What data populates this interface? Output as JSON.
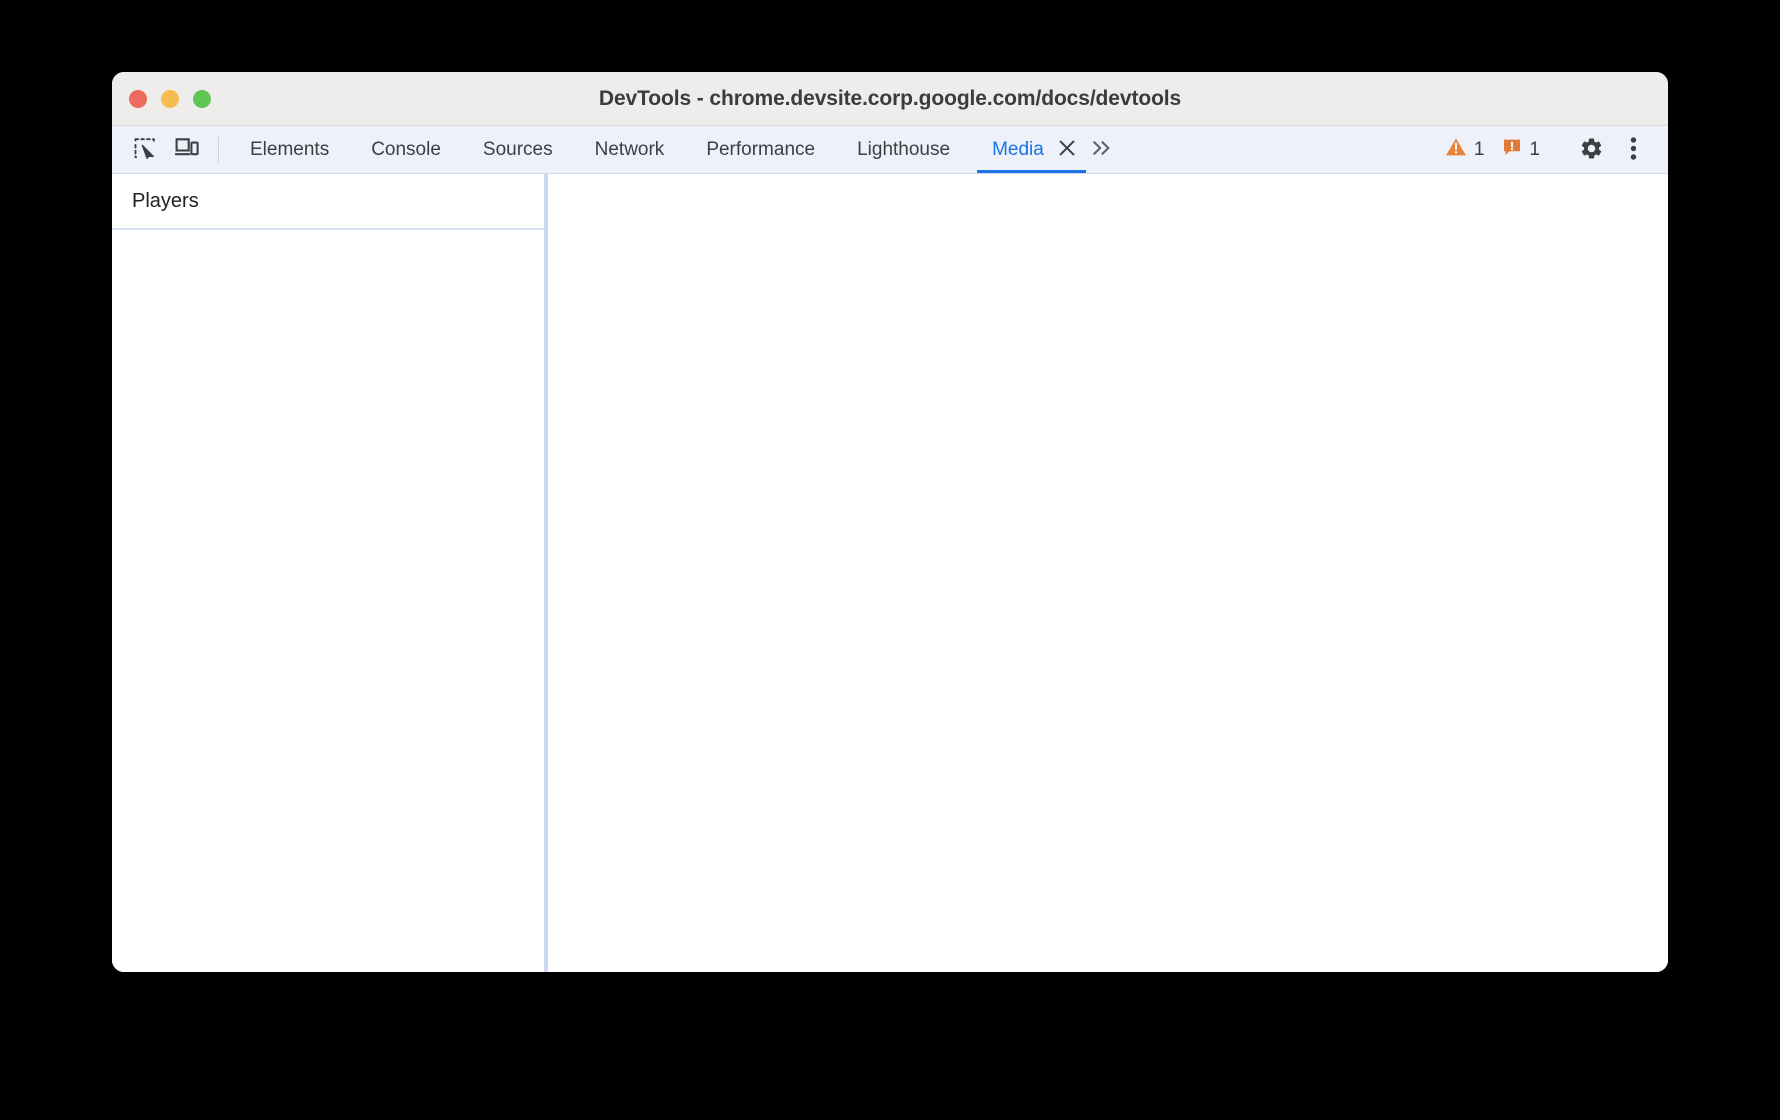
{
  "window": {
    "title": "DevTools - chrome.devsite.corp.google.com/docs/devtools",
    "traffic_lights": {
      "close_label": "Close",
      "minimize_label": "Minimize",
      "maximize_label": "Maximize"
    }
  },
  "toolbar": {
    "inspect_icon": "inspect-element-icon",
    "device_toolbar_icon": "device-toggle-icon"
  },
  "tabs": [
    {
      "label": "Elements",
      "active": false
    },
    {
      "label": "Console",
      "active": false
    },
    {
      "label": "Sources",
      "active": false
    },
    {
      "label": "Network",
      "active": false
    },
    {
      "label": "Performance",
      "active": false
    },
    {
      "label": "Lighthouse",
      "active": false
    },
    {
      "label": "Media",
      "active": true
    }
  ],
  "tab_controls": {
    "close_icon": "close-icon",
    "more_tabs_icon": "double-chevron-right-icon"
  },
  "status": {
    "warnings_count": "1",
    "issues_count": "1",
    "warning_icon": "warning-triangle-icon",
    "issue_icon": "issue-bubble-icon",
    "settings_icon": "gear-icon",
    "more_options_icon": "three-dots-vertical-icon"
  },
  "media_panel": {
    "players_header": "Players",
    "players": []
  },
  "colors": {
    "accent_blue": "#1a73e8",
    "warning_orange": "#e8833a",
    "issue_orange": "#e07b39",
    "titlebar_bg": "#efedeb",
    "tabbar_bg": "#eef1fa",
    "divider_blue": "#ccd7f0"
  }
}
